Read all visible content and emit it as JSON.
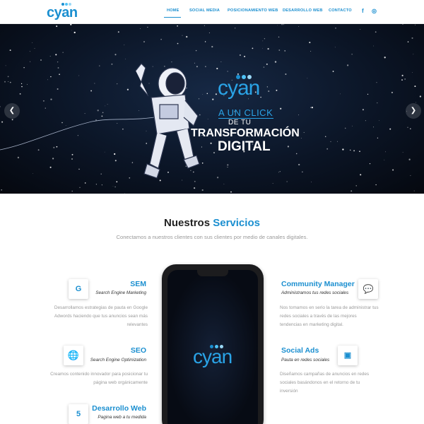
{
  "brand": {
    "name": "cyan",
    "colors": {
      "primary": "#1b8fd0",
      "light": "#2aa3e6",
      "dot1": "#1b8fd0",
      "dot2": "#4fc3f7",
      "dot3": "#9ad8f5"
    }
  },
  "nav": {
    "items": [
      "HOME",
      "SOCIAL MEDIA",
      "POSICIONAMIENTO WEB",
      "DESARROLLO WEB",
      "CONTACTO"
    ],
    "active": "HOME",
    "social": {
      "facebook": "f",
      "instagram": "◎"
    }
  },
  "hero": {
    "brand": "cyan",
    "line1": "A UN CLICK",
    "line2": "DE TU",
    "line3": "TRANSFORMACIÓN",
    "line4": "DIGITAL",
    "prev": "❮",
    "next": "❯"
  },
  "services": {
    "title_main": "Nuestros",
    "title_accent": "Servicios",
    "subtitle": "Conectamos a nuestros clientes con sus clientes por medio de canales digitales.",
    "phone_brand": "cyan",
    "items": [
      {
        "title": "SEM",
        "subtitle": "Search Engine Marketing",
        "icon": "google-icon",
        "glyph": "G",
        "desc": "Desarrollamos estrategias de pauta en Google Adwords haciendo que tus anuncios sean más relevantes"
      },
      {
        "title": "SEO",
        "subtitle": "Search Engine Optimization",
        "icon": "globe-icon",
        "glyph": "🌐",
        "desc": "Creamos contenido innovador para posicionar tu página web orgánicamente"
      },
      {
        "title": "Desarrollo Web",
        "subtitle": "Pagina web a tu medida",
        "icon": "html5-icon",
        "glyph": "5",
        "desc": ""
      },
      {
        "title": "Community Manager",
        "subtitle": "Administramos tus redes sociales",
        "icon": "chat-icon",
        "glyph": "💬",
        "desc": "Nos tomamos en serio la tarea de administrar tus redes sociales a través de las mejores tendencias en marketing digital."
      },
      {
        "title": "Social Ads",
        "subtitle": "Pauta en redes sociales",
        "icon": "ads-icon",
        "glyph": "▣",
        "desc": "Diseñamos campañas de anuncios en redes sociales basándonos en el retorno de tu inversión"
      }
    ]
  }
}
